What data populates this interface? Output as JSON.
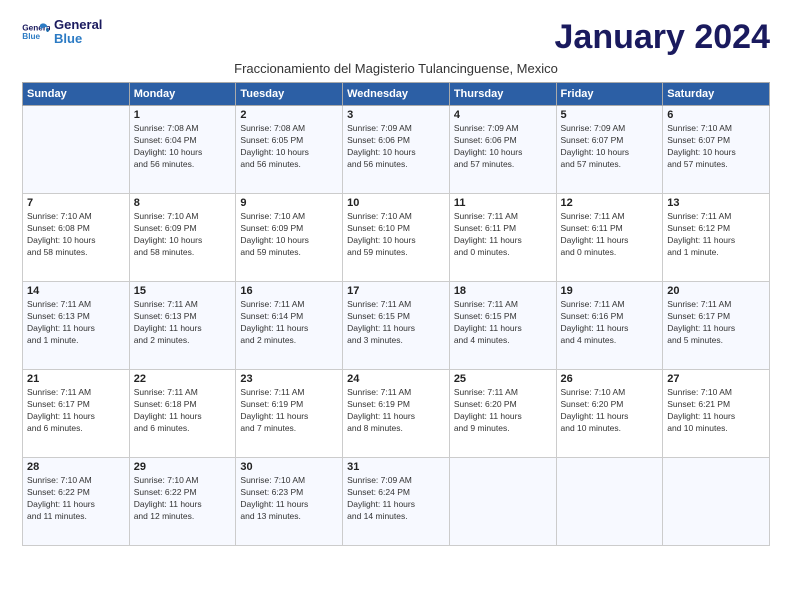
{
  "header": {
    "logo_line1": "General",
    "logo_line2": "Blue",
    "month_title": "January 2024",
    "subtitle": "Fraccionamiento del Magisterio Tulancinguense, Mexico"
  },
  "days_of_week": [
    "Sunday",
    "Monday",
    "Tuesday",
    "Wednesday",
    "Thursday",
    "Friday",
    "Saturday"
  ],
  "weeks": [
    [
      {
        "day": "",
        "info": ""
      },
      {
        "day": "1",
        "info": "Sunrise: 7:08 AM\nSunset: 6:04 PM\nDaylight: 10 hours\nand 56 minutes."
      },
      {
        "day": "2",
        "info": "Sunrise: 7:08 AM\nSunset: 6:05 PM\nDaylight: 10 hours\nand 56 minutes."
      },
      {
        "day": "3",
        "info": "Sunrise: 7:09 AM\nSunset: 6:06 PM\nDaylight: 10 hours\nand 56 minutes."
      },
      {
        "day": "4",
        "info": "Sunrise: 7:09 AM\nSunset: 6:06 PM\nDaylight: 10 hours\nand 57 minutes."
      },
      {
        "day": "5",
        "info": "Sunrise: 7:09 AM\nSunset: 6:07 PM\nDaylight: 10 hours\nand 57 minutes."
      },
      {
        "day": "6",
        "info": "Sunrise: 7:10 AM\nSunset: 6:07 PM\nDaylight: 10 hours\nand 57 minutes."
      }
    ],
    [
      {
        "day": "7",
        "info": "Sunrise: 7:10 AM\nSunset: 6:08 PM\nDaylight: 10 hours\nand 58 minutes."
      },
      {
        "day": "8",
        "info": "Sunrise: 7:10 AM\nSunset: 6:09 PM\nDaylight: 10 hours\nand 58 minutes."
      },
      {
        "day": "9",
        "info": "Sunrise: 7:10 AM\nSunset: 6:09 PM\nDaylight: 10 hours\nand 59 minutes."
      },
      {
        "day": "10",
        "info": "Sunrise: 7:10 AM\nSunset: 6:10 PM\nDaylight: 10 hours\nand 59 minutes."
      },
      {
        "day": "11",
        "info": "Sunrise: 7:11 AM\nSunset: 6:11 PM\nDaylight: 11 hours\nand 0 minutes."
      },
      {
        "day": "12",
        "info": "Sunrise: 7:11 AM\nSunset: 6:11 PM\nDaylight: 11 hours\nand 0 minutes."
      },
      {
        "day": "13",
        "info": "Sunrise: 7:11 AM\nSunset: 6:12 PM\nDaylight: 11 hours\nand 1 minute."
      }
    ],
    [
      {
        "day": "14",
        "info": "Sunrise: 7:11 AM\nSunset: 6:13 PM\nDaylight: 11 hours\nand 1 minute."
      },
      {
        "day": "15",
        "info": "Sunrise: 7:11 AM\nSunset: 6:13 PM\nDaylight: 11 hours\nand 2 minutes."
      },
      {
        "day": "16",
        "info": "Sunrise: 7:11 AM\nSunset: 6:14 PM\nDaylight: 11 hours\nand 2 minutes."
      },
      {
        "day": "17",
        "info": "Sunrise: 7:11 AM\nSunset: 6:15 PM\nDaylight: 11 hours\nand 3 minutes."
      },
      {
        "day": "18",
        "info": "Sunrise: 7:11 AM\nSunset: 6:15 PM\nDaylight: 11 hours\nand 4 minutes."
      },
      {
        "day": "19",
        "info": "Sunrise: 7:11 AM\nSunset: 6:16 PM\nDaylight: 11 hours\nand 4 minutes."
      },
      {
        "day": "20",
        "info": "Sunrise: 7:11 AM\nSunset: 6:17 PM\nDaylight: 11 hours\nand 5 minutes."
      }
    ],
    [
      {
        "day": "21",
        "info": "Sunrise: 7:11 AM\nSunset: 6:17 PM\nDaylight: 11 hours\nand 6 minutes."
      },
      {
        "day": "22",
        "info": "Sunrise: 7:11 AM\nSunset: 6:18 PM\nDaylight: 11 hours\nand 6 minutes."
      },
      {
        "day": "23",
        "info": "Sunrise: 7:11 AM\nSunset: 6:19 PM\nDaylight: 11 hours\nand 7 minutes."
      },
      {
        "day": "24",
        "info": "Sunrise: 7:11 AM\nSunset: 6:19 PM\nDaylight: 11 hours\nand 8 minutes."
      },
      {
        "day": "25",
        "info": "Sunrise: 7:11 AM\nSunset: 6:20 PM\nDaylight: 11 hours\nand 9 minutes."
      },
      {
        "day": "26",
        "info": "Sunrise: 7:10 AM\nSunset: 6:20 PM\nDaylight: 11 hours\nand 10 minutes."
      },
      {
        "day": "27",
        "info": "Sunrise: 7:10 AM\nSunset: 6:21 PM\nDaylight: 11 hours\nand 10 minutes."
      }
    ],
    [
      {
        "day": "28",
        "info": "Sunrise: 7:10 AM\nSunset: 6:22 PM\nDaylight: 11 hours\nand 11 minutes."
      },
      {
        "day": "29",
        "info": "Sunrise: 7:10 AM\nSunset: 6:22 PM\nDaylight: 11 hours\nand 12 minutes."
      },
      {
        "day": "30",
        "info": "Sunrise: 7:10 AM\nSunset: 6:23 PM\nDaylight: 11 hours\nand 13 minutes."
      },
      {
        "day": "31",
        "info": "Sunrise: 7:09 AM\nSunset: 6:24 PM\nDaylight: 11 hours\nand 14 minutes."
      },
      {
        "day": "",
        "info": ""
      },
      {
        "day": "",
        "info": ""
      },
      {
        "day": "",
        "info": ""
      }
    ]
  ]
}
